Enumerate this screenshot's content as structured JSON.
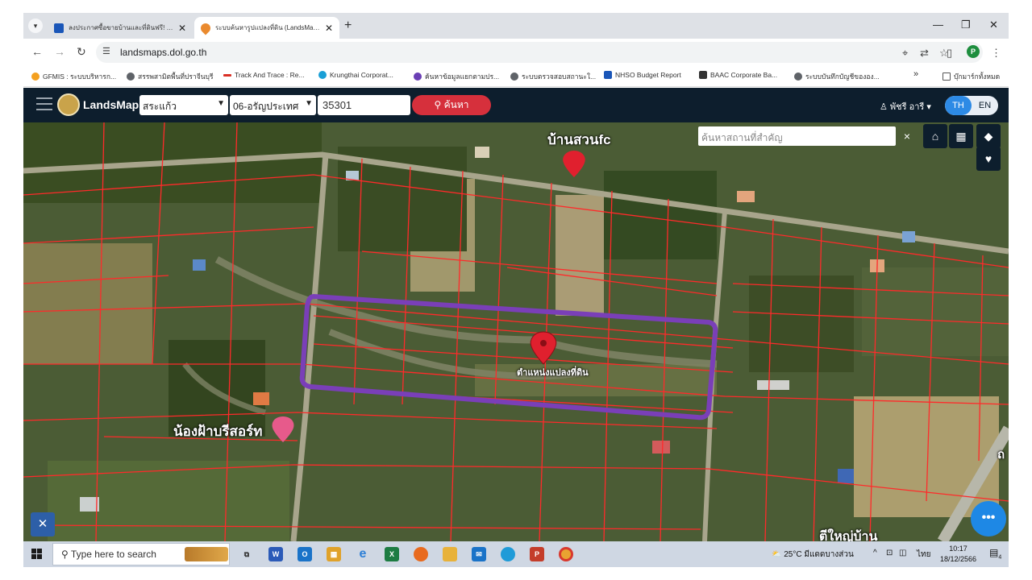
{
  "browser": {
    "tabs": [
      {
        "title": "ลงประกาศซื้อขายบ้านและที่ดินฟรี! | ...",
        "active": false
      },
      {
        "title": "ระบบค้นหารูปแปลงที่ดิน (LandsMaps)",
        "active": true
      }
    ],
    "new_tab": "+",
    "url": "landsmaps.dol.go.th",
    "bookmarks": [
      {
        "label": "GFMIS : ระบบบริหารก...",
        "icon_color": "#f4a020"
      },
      {
        "label": "สรรพสามิตพื้นที่ปราจีนบุรี",
        "icon_color": "#5f6368"
      },
      {
        "label": "Track And Trace : Re...",
        "icon_color": "#d93025"
      },
      {
        "label": "Krungthai Corporat...",
        "icon_color": "#1a9fd6"
      },
      {
        "label": "ค้นหาข้อมูลแยกตามปร...",
        "icon_color": "#6a3fb5"
      },
      {
        "label": "ระบบตรวจสอบสถานะใ...",
        "icon_color": "#5f6368"
      },
      {
        "label": "NHSO Budget Report",
        "icon_color": "#1a56b8"
      },
      {
        "label": "BAAC Corporate Ba...",
        "icon_color": "#333333"
      },
      {
        "label": "ระบบบันทึกบัญชีขององ...",
        "icon_color": "#5f6368"
      }
    ],
    "bookmarks_more": "»",
    "bookmarks_folder": "บุ๊กมาร์กทั้งหมด",
    "profile_initial": "P"
  },
  "app": {
    "logo_text": "LandsMaps",
    "province": "สระแก้ว",
    "district": "06-อรัญประเทศ",
    "parcel_number": "35301",
    "search_label": "ค้นหา",
    "user_name": "พัชรี อารี",
    "lang_th": "TH",
    "lang_en": "EN"
  },
  "map": {
    "search_placeholder": "ค้นหาสถานที่สำคัญ",
    "clear": "×",
    "fab": "•••",
    "labels": {
      "village": "บ้านสวนfc",
      "resort": "น้องฝ้าบรีสอร์ท",
      "parcel": "ตำแหน่งแปลงที่ดิน",
      "bottom": "ตีใหญ่บ้าน",
      "edge": "ถ"
    },
    "colors": {
      "parcel_lines": "#ff2a2a",
      "highlight": "#7a3fb8",
      "marker": "#e0202e"
    }
  },
  "taskbar": {
    "search_placeholder": "Type here to search",
    "weather": "25°C มีแดดบางส่วน",
    "ime": "ไทย",
    "time": "10:17",
    "date": "18/12/2566",
    "notif_count": "4"
  }
}
